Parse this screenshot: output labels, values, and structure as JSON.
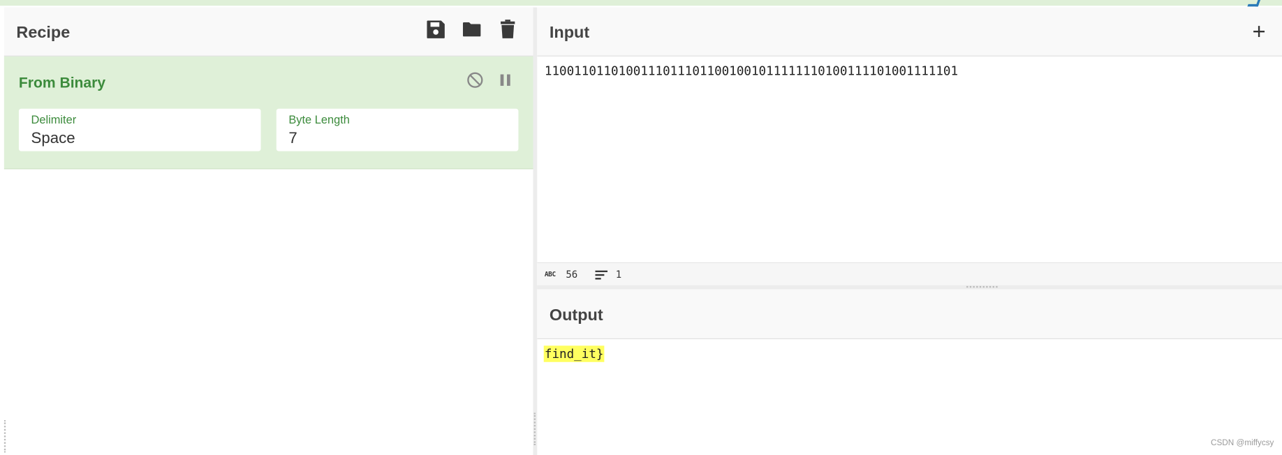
{
  "recipe": {
    "title": "Recipe",
    "icons": [
      "save-icon",
      "folder-icon",
      "trash-icon"
    ]
  },
  "operation": {
    "title": "From Binary",
    "icons": [
      "disable-icon",
      "pause-icon"
    ],
    "delimiter": {
      "label": "Delimiter",
      "value": "Space"
    },
    "byte_length": {
      "label": "Byte Length",
      "value": "7"
    }
  },
  "input": {
    "title": "Input",
    "add_icon": "+",
    "text": "11001101101001110111011001001011111110100111101001111101",
    "status": {
      "chars": "56",
      "lines": "1"
    }
  },
  "output": {
    "title": "Output",
    "text": "find_it}"
  },
  "watermark": "CSDN @miffycsy",
  "colors": {
    "accent": "#3c8b3c",
    "operation_bg": "#dff0d8",
    "highlight": "#ffff60"
  }
}
